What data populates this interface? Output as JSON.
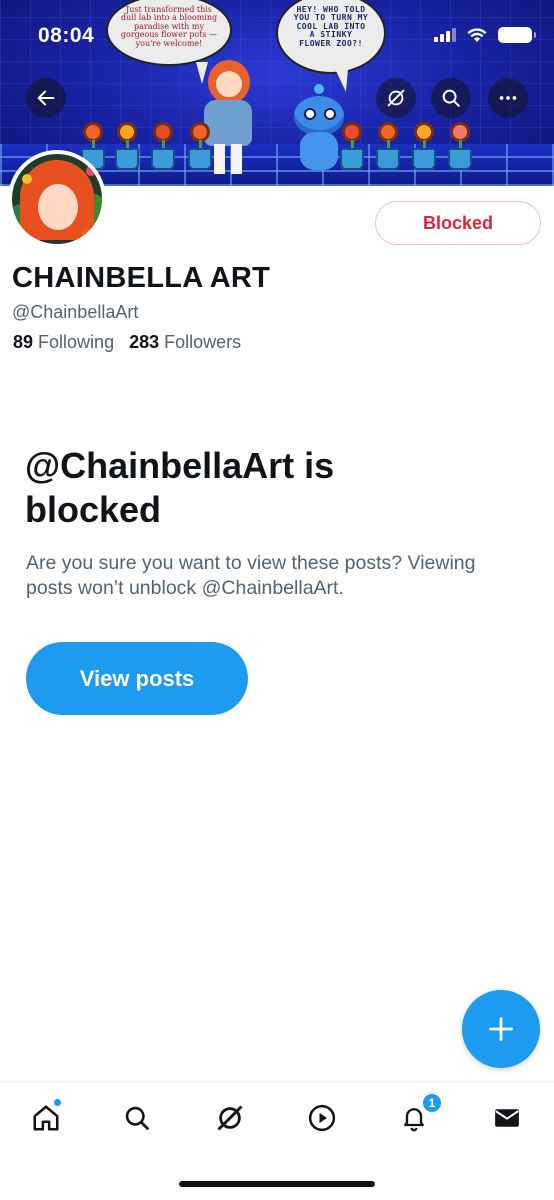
{
  "status_bar": {
    "time": "08:04"
  },
  "banner": {
    "bubble_left_text": "Just transformed this dull lab into a blooming paradise with my gorgeous flower pots — you're welcome!",
    "bubble_right_text": "HEY! WHO TOLD YOU TO TURN MY COOL LAB INTO A STINKY FLOWER ZOO?!"
  },
  "nav": {
    "back_icon": "arrow-left-icon",
    "grok_icon": "grok-icon",
    "search_icon": "search-icon",
    "more_icon": "more-icon"
  },
  "profile": {
    "blocked_label": "Blocked",
    "display_name": "CHAINBELLA ART",
    "handle": "@ChainbellaArt",
    "following_count": "89",
    "following_label": "Following",
    "followers_count": "283",
    "followers_label": "Followers"
  },
  "blocked_notice": {
    "title": "@ChainbellaArt is blocked",
    "description": "Are you sure you want to view these posts? Viewing posts won’t unblock @ChainbellaArt.",
    "view_posts_label": "View posts"
  },
  "fab": {
    "icon": "plus-icon"
  },
  "tabbar": {
    "items": [
      {
        "name": "home",
        "icon": "home-icon",
        "has_dot": true
      },
      {
        "name": "search",
        "icon": "search-icon"
      },
      {
        "name": "grok",
        "icon": "grok-icon"
      },
      {
        "name": "video",
        "icon": "play-icon"
      },
      {
        "name": "notifications",
        "icon": "bell-icon",
        "badge": "1"
      },
      {
        "name": "messages",
        "icon": "mail-icon"
      }
    ]
  },
  "colors": {
    "accent": "#1d9bf0",
    "blocked_red": "#e0243a",
    "text_primary": "#0f1419",
    "text_secondary": "#536471"
  }
}
